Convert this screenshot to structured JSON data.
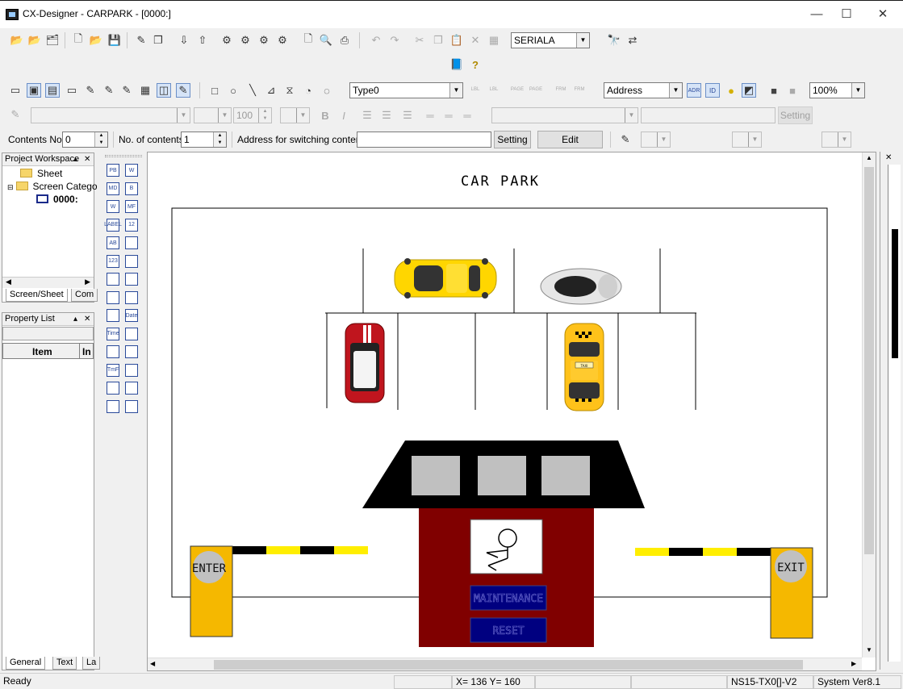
{
  "window": {
    "title": "CX-Designer - CARPARK - [0000:]",
    "minimize": "—",
    "maximize": "☐",
    "close": "✕"
  },
  "toolbar1": {
    "serial_combo": "SERIALA"
  },
  "toolbar3": {
    "type_combo": "Type0",
    "address_combo": "Address",
    "zoom_combo": "100%",
    "lbl1": "LBL",
    "lbl2": "LBL",
    "page1": "PAGE",
    "page2": "PAGE",
    "frm1": "FRM",
    "frm2": "FRM",
    "adr": "ADR",
    "id": "ID"
  },
  "toolbar4": {
    "size_value": "100",
    "setting_label": "Setting"
  },
  "toolbar5": {
    "contents_no_label": "Contents No.",
    "contents_no_value": "0",
    "no_of_contents_label": "No. of contents",
    "no_of_contents_value": "1",
    "address_switch_label": "Address for switching contents",
    "setting_button": "Setting",
    "edit_contents_button": "Edit Contents..."
  },
  "workspace": {
    "title": "Project Workspace",
    "items": [
      "Sheet",
      "Screen Catego",
      "0000:"
    ],
    "tabs": [
      "Screen/Sheet",
      "Com"
    ]
  },
  "property_list": {
    "title": "Property List",
    "col_item": "Item",
    "col_in": "In",
    "tabs": [
      "General",
      "Text",
      "La"
    ]
  },
  "palette": [
    "PB",
    "W",
    "MD",
    "B",
    "W",
    "MF",
    "LABEL",
    "12",
    "AB",
    "",
    "123",
    "",
    "",
    "",
    "",
    "",
    "",
    "Date",
    "Time",
    "",
    "",
    "",
    "TmF",
    "",
    "",
    "",
    "",
    ""
  ],
  "screen": {
    "title": "CAR PARK",
    "enter_label": "ENTER",
    "exit_label": "EXIT",
    "maintenance_label": "MAINTENANCE",
    "reset_label": "RESET",
    "taxi_label": "TAXI"
  },
  "status": {
    "ready": "Ready",
    "coords": "X= 136 Y= 160",
    "device": "NS15-TX0[]-V2",
    "version": "System Ver8.1"
  },
  "colors": {
    "booth_red": "#800000",
    "booth_roof": "#000000",
    "gate_post": "#f5b800",
    "button_navy": "#000080",
    "barrier_yellow": "#ffee00"
  }
}
